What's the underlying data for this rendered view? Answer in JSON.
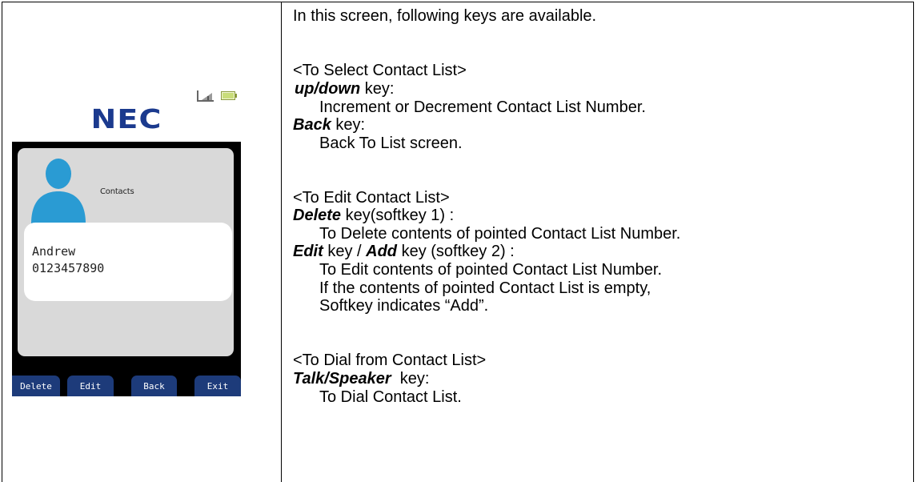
{
  "phone": {
    "brand": "NEC",
    "panel_title": "Contacts",
    "contact": {
      "name": "Andrew",
      "number": "0123457890"
    },
    "softkeys": [
      "Delete",
      "Edit",
      "Back",
      "Exit"
    ],
    "icons": [
      "signal-icon",
      "battery-icon",
      "contact-avatar-icon"
    ],
    "colors": {
      "brand": "#1b3a8e",
      "softkey_bg": "#1d3b7a",
      "avatar": "#2a9bd3",
      "panel": "#d9d9d9"
    }
  },
  "description": {
    "intro": "In this screen, following keys are available.",
    "select_heading": "<To Select Contact List>",
    "updown_key": "up/down",
    "updown_suffix": " key:",
    "updown_desc": "Increment or Decrement Contact List Number.",
    "back_key": "Back",
    "back_suffix": " key:",
    "back_desc": "Back To List screen.",
    "edit_heading": "<To Edit Contact List>",
    "delete_key": "Delete",
    "delete_suffix": " key(softkey 1) :",
    "delete_desc": "To Delete contents of pointed Contact List Number.",
    "edit_key": "Edit",
    "edit_mid": " key / ",
    "add_key": "Add",
    "add_suffix": " key (softkey 2) :",
    "edit_desc_1": "To Edit contents of pointed Contact List Number.",
    "edit_desc_2": "If the contents of pointed Contact List is empty,",
    "edit_desc_3": "Softkey indicates “Add”.",
    "dial_heading": "<To Dial from Contact List>",
    "talk_key": "Talk/Speaker",
    "talk_suffix": "  key:",
    "talk_desc": "To Dial Contact List."
  }
}
